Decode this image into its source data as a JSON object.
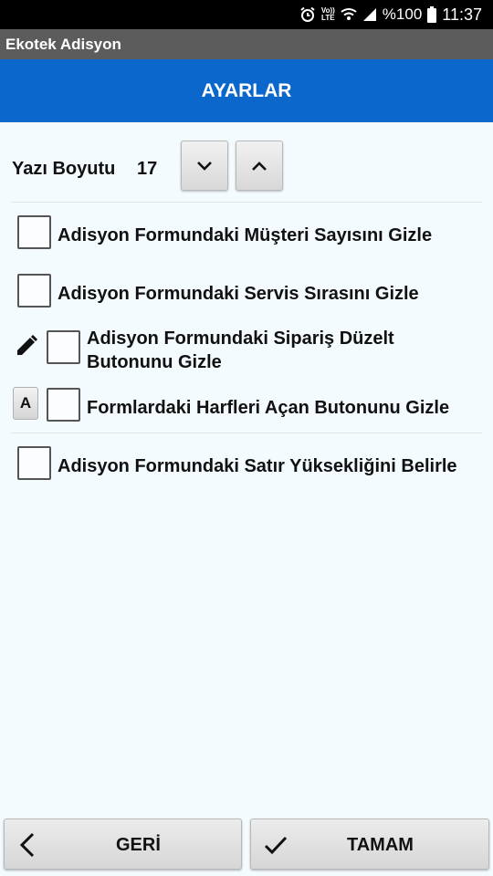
{
  "status_bar": {
    "battery_text": "%100",
    "time": "11:37",
    "volte_top": "Vo))",
    "volte_bottom": "LTE"
  },
  "app_title": "Ekotek Adisyon",
  "header_title": "AYARLAR",
  "font_size": {
    "label": "Yazı Boyutu",
    "value": "17"
  },
  "options": [
    {
      "label": "Adisyon Formundaki Müşteri Sayısını Gizle",
      "checked": false
    },
    {
      "label": "Adisyon Formundaki Servis Sırasını Gizle",
      "checked": false
    },
    {
      "label_line1": "Adisyon Formundaki Sipariş Düzelt",
      "label_line2": "Butonunu Gizle",
      "checked": false,
      "icon": "pencil-icon"
    },
    {
      "label": "Formlardaki Harfleri Açan Butonunu Gizle",
      "checked": false,
      "badge": "A"
    },
    {
      "label": "Adisyon Formundaki Satır Yüksekliğini Belirle",
      "checked": false
    }
  ],
  "buttons": {
    "back": "GERİ",
    "ok": "TAMAM"
  }
}
